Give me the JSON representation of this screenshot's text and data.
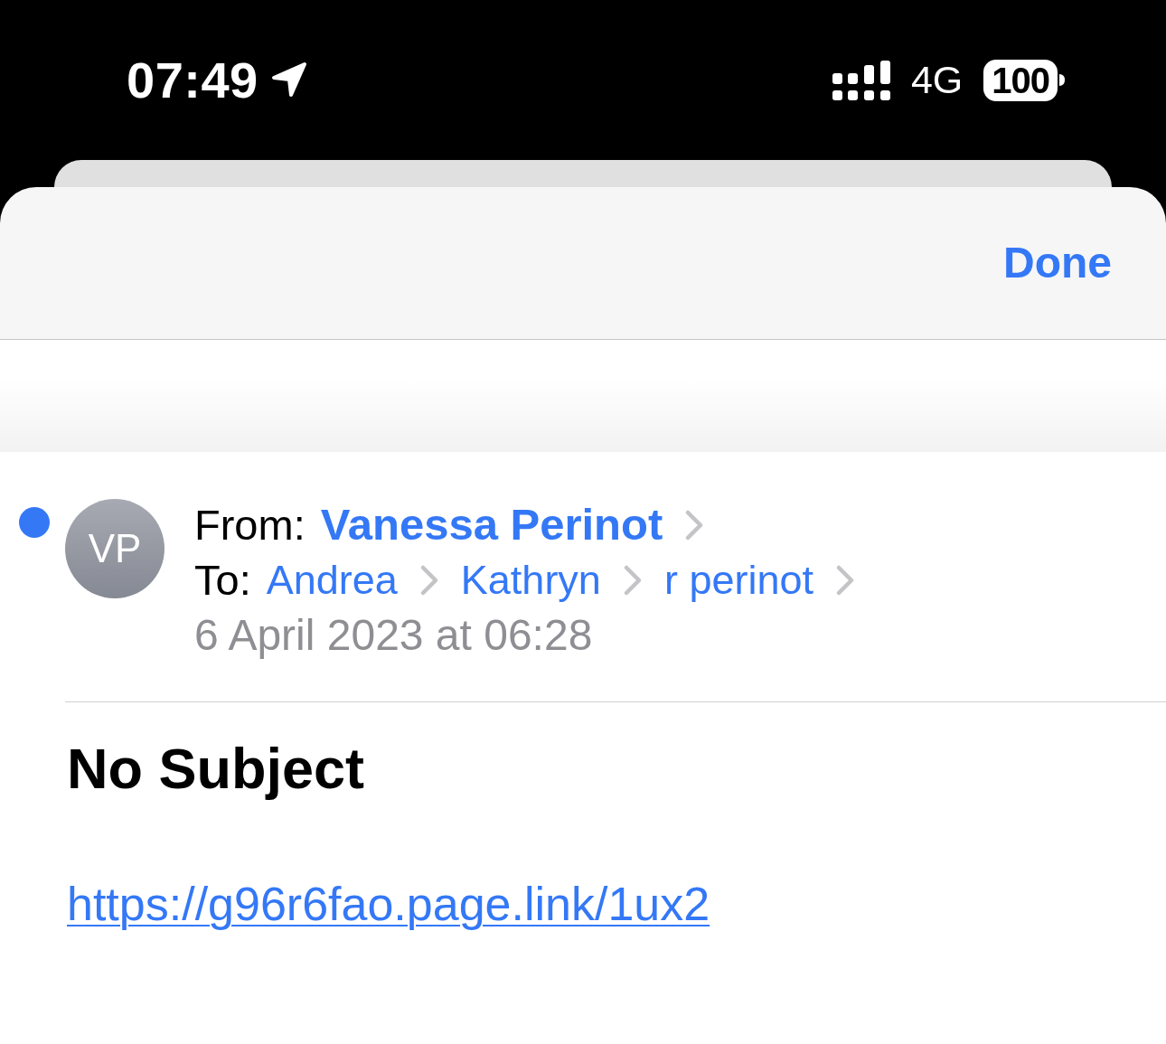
{
  "status_bar": {
    "time": "07:49",
    "network": "4G",
    "battery": "100"
  },
  "sheet": {
    "done_button": "Done"
  },
  "message": {
    "unread": true,
    "avatar_initials": "VP",
    "from_label": "From:",
    "from": "Vanessa Perinot",
    "to_label": "To:",
    "to": [
      "Andrea",
      "Kathryn",
      "r perinot"
    ],
    "date": "6 April 2023 at 06:28",
    "subject": "No Subject",
    "body_link": "https://g96r6fao.page.link/1ux2"
  }
}
